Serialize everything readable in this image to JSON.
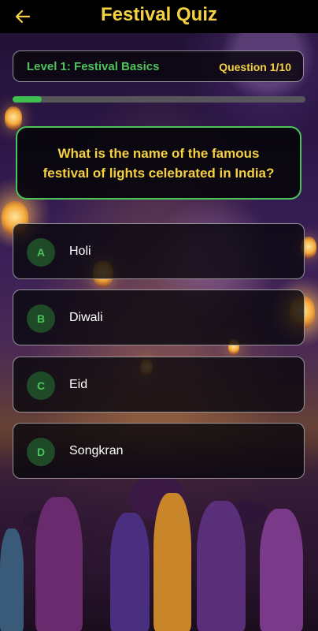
{
  "header": {
    "title": "Festival Quiz",
    "back_icon": "arrow-left-icon"
  },
  "level": {
    "label": "Level 1: Festival Basics",
    "question_count": "Question 1/10",
    "progress_fraction": 0.1
  },
  "question": {
    "text": "What is the name of the famous festival of lights celebrated in India?"
  },
  "options": [
    {
      "letter": "A",
      "text": "Holi"
    },
    {
      "letter": "B",
      "text": "Diwali"
    },
    {
      "letter": "C",
      "text": "Eid"
    },
    {
      "letter": "D",
      "text": "Songkran"
    }
  ],
  "colors": {
    "accent_yellow": "#f5d142",
    "accent_green": "#4cc45a",
    "header_bg": "#000000"
  }
}
